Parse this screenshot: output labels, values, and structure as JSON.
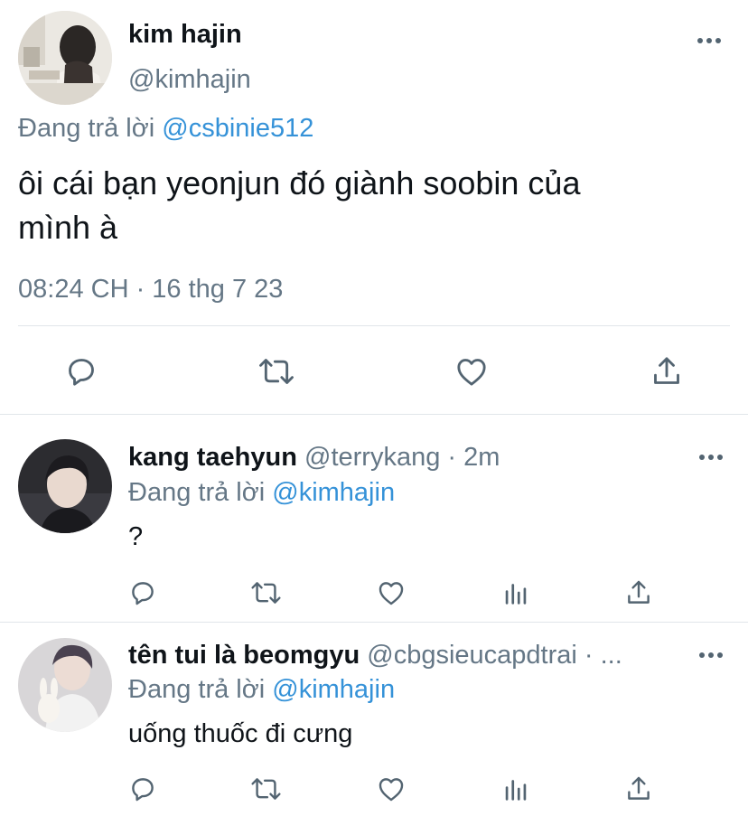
{
  "main_tweet": {
    "display_name": "kim hajin",
    "handle": "@kimhajin",
    "reply_prefix": "Đang trả lời",
    "reply_to": "@csbinie512",
    "text_line1": "ôi cái bạn yeonjun đó giành soobin của",
    "text_line2": "mình à",
    "timestamp": "08:24 CH · 16 thg 7 23"
  },
  "replies": [
    {
      "display_name": "kang taehyun",
      "handle": "@terrykang",
      "time": "· 2m",
      "reply_prefix": "Đang trả lời",
      "reply_to": "@kimhajin",
      "text": "?"
    },
    {
      "display_name": "tên tui là beomgyu",
      "handle": "@cbgsieucapdtrai",
      "time": "· ...",
      "reply_prefix": "Đang trả lời",
      "reply_to": "@kimhajin",
      "text": "uống thuốc đi cưng"
    }
  ],
  "colors": {
    "link": "#3592d8",
    "secondary_text": "#657786",
    "icon": "#536471",
    "separator": "#e9ecef"
  },
  "icons": [
    "more-icon",
    "reply-icon",
    "retweet-icon",
    "like-icon",
    "analytics-icon",
    "share-icon"
  ]
}
